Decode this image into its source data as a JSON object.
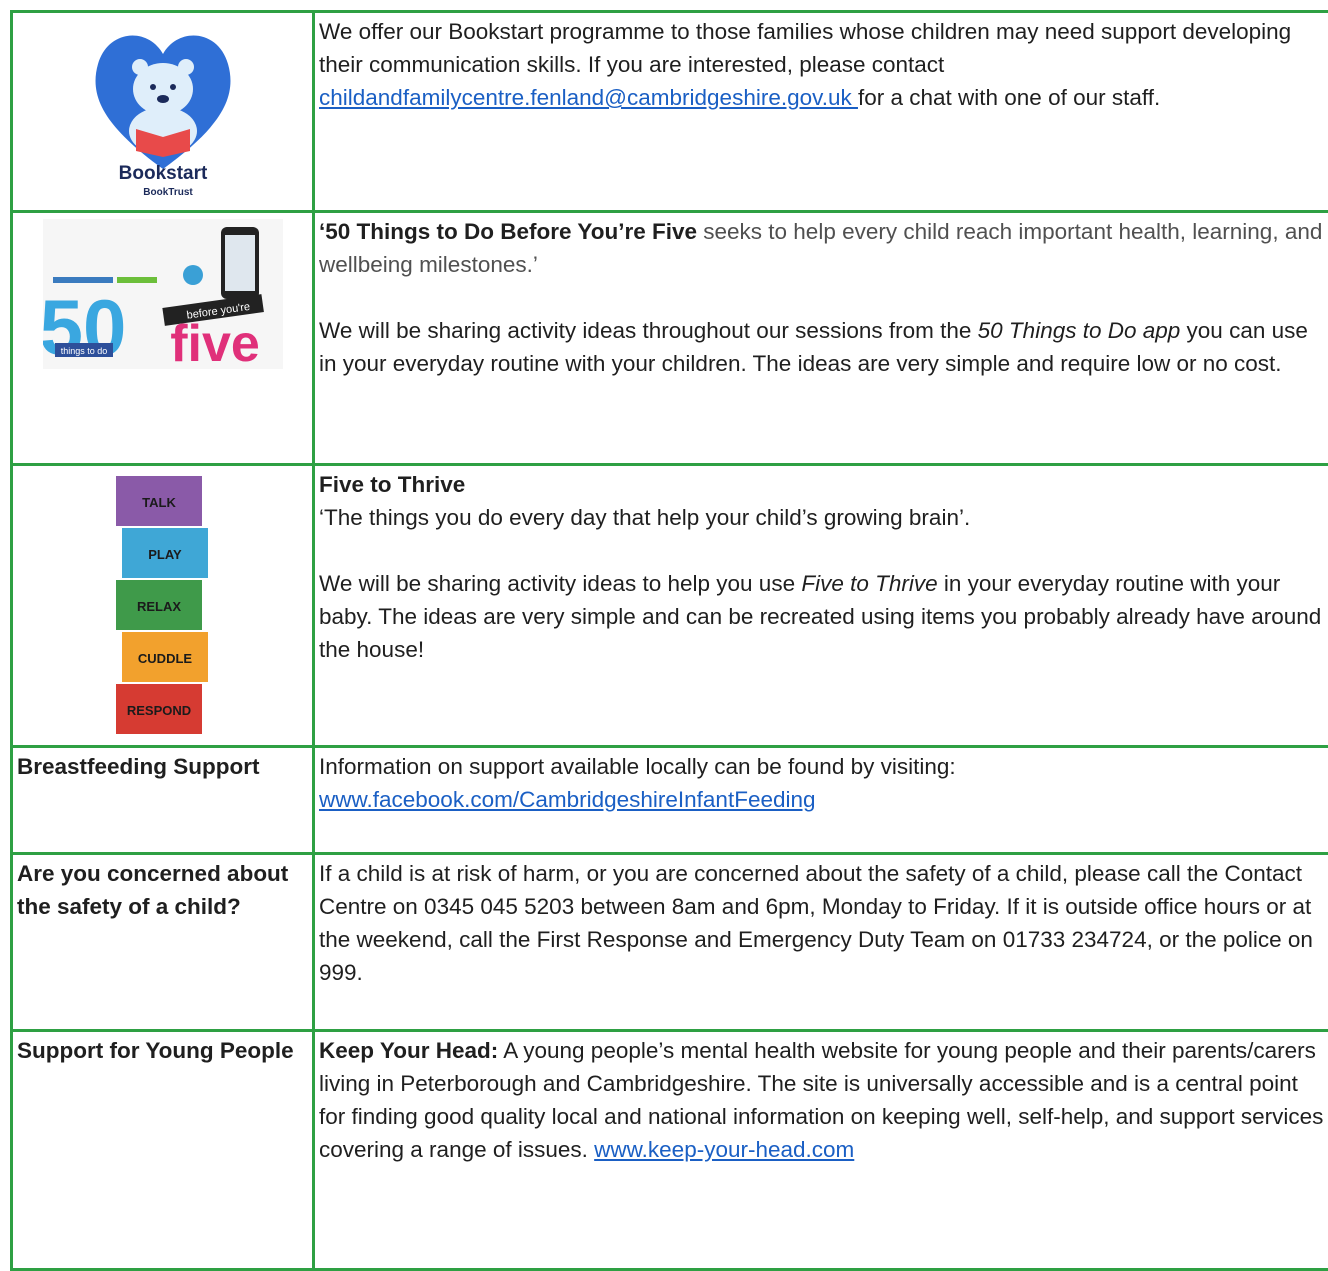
{
  "rows": [
    {
      "image": {
        "name": "bookstart-logo",
        "title": "Bookstart",
        "subtitle": "BookTrust"
      },
      "text_pre": "We offer our Bookstart programme to those families whose children may need support developing their communication skills. If you are interested, please contact ",
      "link": "childandfamilycentre.fenland@cambridgeshire.gov.uk ",
      "text_post": "for a chat with one of our staff."
    },
    {
      "image": {
        "name": "fifty-things-logo",
        "big_number": "50",
        "small_text": "things to do",
        "banner": "before you're",
        "word": "five"
      },
      "bold_lead": "‘50 Things to Do Before You’re Five",
      "lead_rest": " seeks to help every child reach important health, learning, and wellbeing milestones.’",
      "para2_pre": "We will be sharing activity ideas throughout our sessions from the ",
      "para2_ital": "50 Things to Do app",
      "para2_post": " you can use in your everyday routine with your children. The ideas are very simple and require low or no cost."
    },
    {
      "image": {
        "name": "five-to-thrive-blocks",
        "blocks": [
          "TALK",
          "PLAY",
          "RELAX",
          "CUDDLE",
          "RESPOND"
        ],
        "block_colors": [
          "#8a5aa8",
          "#3fa7d6",
          "#3f9a4a",
          "#f2a12d",
          "#d63b32"
        ]
      },
      "heading": "Five to Thrive",
      "quote": "‘The things you do every day that help your child’s growing brain’.",
      "para2_pre": " We will be sharing activity ideas to help you use ",
      "para2_ital": "Five to Thrive",
      "para2_post": " in your everyday routine with your baby. The ideas are very simple and can be recreated using items you probably already have around the house!"
    },
    {
      "label": "Breastfeeding Support",
      "text": "Information on support available locally can be found by visiting:",
      "link": "www.facebook.com/CambridgeshireInfantFeeding"
    },
    {
      "label": "Are you concerned about the safety of a child?",
      "text": "If a child is at risk of harm, or you are concerned about the safety of a child, please call the Contact Centre on 0345 045 5203 between 8am and 6pm, Monday to Friday. If it is outside office hours or at the weekend, call the First Response and Emergency Duty Team on 01733 234724, or the police on 999."
    },
    {
      "label": "Support for Young People",
      "bold_lead": "Keep Your Head:",
      "text": " A young people’s mental health website for young people and their parents/carers living in Peterborough and Cambridgeshire. The site is universally accessible and is a central point for finding good quality local and national information on keeping well, self-help, and support services covering a range of issues.  ",
      "link": "www.keep-your-head.com"
    }
  ],
  "colors": {
    "border": "#2ea043",
    "link": "#1a5fc4"
  }
}
